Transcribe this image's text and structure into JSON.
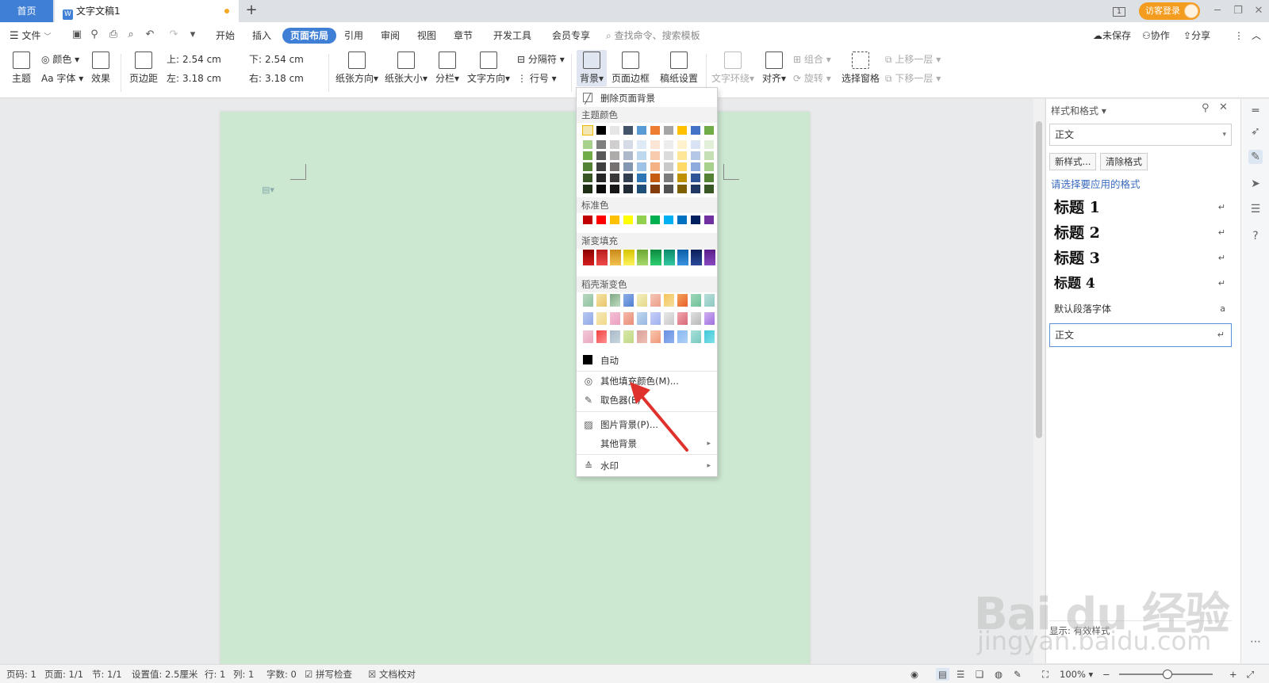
{
  "titlebar": {
    "home_tab": "首页",
    "doc_tab": "文字文稿1",
    "doc_icon": "W",
    "new_tab": "+",
    "login": "访客登录",
    "page_indicator": "1"
  },
  "menubar": {
    "file": "文件",
    "tabs": [
      "开始",
      "插入",
      "页面布局",
      "引用",
      "审阅",
      "视图",
      "章节",
      "开发工具",
      "会员专享"
    ],
    "active_tab": "页面布局",
    "search_placeholder": "查找命令、搜索模板",
    "unsaved": "未保存",
    "collab": "协作",
    "share": "分享"
  },
  "ribbon": {
    "theme": "主题",
    "colors": "颜色",
    "font": "字体",
    "effects": "效果",
    "margins": "页边距",
    "top_label": "上:",
    "top_value": "2.54 cm",
    "bottom_label": "下:",
    "bottom_value": "2.54 cm",
    "left_label": "左:",
    "left_value": "3.18 cm",
    "right_label": "右:",
    "right_value": "3.18 cm",
    "orientation": "纸张方向",
    "size": "纸张大小",
    "columns": "分栏",
    "text_direction": "文字方向",
    "breaks": "分隔符",
    "line_numbers": "行号",
    "background": "背景",
    "page_border": "页面边框",
    "manuscript": "稿纸设置",
    "text_wrap": "文字环绕",
    "align": "对齐",
    "group": "组合",
    "rotate": "旋转",
    "selection_pane": "选择窗格",
    "bring_forward": "上移一层",
    "send_backward": "下移一层"
  },
  "dropdown": {
    "delete_bg": "删除页面背景",
    "theme_colors_label": "主题颜色",
    "standard_colors_label": "标准色",
    "gradient_label": "渐变填充",
    "docer_gradient_label": "稻壳渐变色",
    "auto": "自动",
    "more_colors": "其他填充颜色(M)...",
    "eyedropper": "取色器(E)",
    "picture_bg": "图片背景(P)...",
    "other_bg": "其他背景",
    "watermark": "水印",
    "theme_top_row": [
      "#f4e6b3",
      "#000000",
      "#e7e6e6",
      "#44546a",
      "#5b9bd5",
      "#ed7d31",
      "#a5a5a5",
      "#ffc000",
      "#4472c4",
      "#70ad47"
    ],
    "theme_shades": [
      [
        "#a9d18e",
        "#7f7f7f",
        "#d0cece",
        "#d6dce5",
        "#deebf7",
        "#fbe5d6",
        "#ededed",
        "#fff2cc",
        "#dae3f3",
        "#e2f0d9"
      ],
      [
        "#70ad47",
        "#595959",
        "#aeabab",
        "#adb9ca",
        "#bdd7ee",
        "#f8cbad",
        "#dbdbdb",
        "#ffe699",
        "#b4c7e7",
        "#c5e0b4"
      ],
      [
        "#548235",
        "#3f3f3f",
        "#757171",
        "#8497b0",
        "#9dc3e6",
        "#f4b183",
        "#c9c9c9",
        "#ffd966",
        "#8faadc",
        "#a9d18e"
      ],
      [
        "#375623",
        "#262626",
        "#3a3838",
        "#333f50",
        "#2e75b6",
        "#c55a11",
        "#7b7b7b",
        "#bf9000",
        "#2f5597",
        "#548235"
      ],
      [
        "#1e2e14",
        "#0c0c0c",
        "#171616",
        "#222a35",
        "#1f4e79",
        "#843c0c",
        "#525252",
        "#7f6000",
        "#203864",
        "#385723"
      ]
    ],
    "standard_colors": [
      "#c00000",
      "#ff0000",
      "#ffc000",
      "#ffff00",
      "#92d050",
      "#00b050",
      "#00b0f0",
      "#0070c0",
      "#002060",
      "#7030a0"
    ],
    "gradient_colors": [
      [
        "#8b0000",
        "#d42020"
      ],
      [
        "#b81c1c",
        "#f04a4a"
      ],
      [
        "#c98a1a",
        "#f2c14e"
      ],
      [
        "#d6c400",
        "#fff35c"
      ],
      [
        "#6da834",
        "#a8d86d"
      ],
      [
        "#0c8a3e",
        "#2fcf72"
      ],
      [
        "#0d8a6a",
        "#33c9a0"
      ],
      [
        "#0b5fa8",
        "#3a93e0"
      ],
      [
        "#0b1f5a",
        "#2a4a9a"
      ],
      [
        "#5a1f8a",
        "#8a4ac0"
      ]
    ],
    "docer_gradients": [
      [
        "#b7d8c0",
        "#8fc2a0"
      ],
      [
        "#f6e3a8",
        "#e8c56a"
      ],
      [
        "#7ea884",
        "#c0dcc2"
      ],
      [
        "#8fb0e8",
        "#4f7fd0"
      ],
      [
        "#f3efc0",
        "#e5d98a"
      ],
      [
        "#f5c6b8",
        "#ec9f88"
      ],
      [
        "#f6c45a",
        "#f4e0a0"
      ],
      [
        "#f4a35a",
        "#e8612a"
      ],
      [
        "#a0d8b8",
        "#6cc09a"
      ],
      [
        "#b8e0da",
        "#8cc8c0"
      ],
      [
        "#b8c8f0",
        "#90a8e8"
      ],
      [
        "#f6e9b8",
        "#f0d888"
      ],
      [
        "#f5c0d6",
        "#eaa0c0"
      ],
      [
        "#f6b9a8",
        "#e88e78"
      ],
      [
        "#c0d8f0",
        "#98b8e0"
      ],
      [
        "#c8d0f8",
        "#a0b0f0"
      ],
      [
        "#e8e8e8",
        "#c8c8c8"
      ],
      [
        "#f0a8b0",
        "#d86878"
      ],
      [
        "#e0e0e0",
        "#b8b8b8"
      ],
      [
        "#d0b0f0",
        "#a070e0"
      ],
      [
        "#f4c8d8",
        "#e8a8c0"
      ],
      [
        "#f04040",
        "#ff9090"
      ],
      [
        "#a8b8c8",
        "#c8d8e0"
      ],
      [
        "#d8e8a8",
        "#c0d888"
      ],
      [
        "#d8a0a0",
        "#f0c0b0"
      ],
      [
        "#f8c8b0",
        "#f09878"
      ],
      [
        "#6890e0",
        "#90b0f0"
      ],
      [
        "#88b8f0",
        "#b0d0f8"
      ],
      [
        "#a8e0d8",
        "#78c8c0"
      ],
      [
        "#40c8d8",
        "#80e0e8"
      ]
    ]
  },
  "sidepanel": {
    "title": "样式和格式",
    "current_style": "正文",
    "new_style": "新样式...",
    "clear_format": "清除格式",
    "choose_label": "请选择要应用的格式",
    "styles": [
      {
        "name": "标题  1",
        "kind": "heading"
      },
      {
        "name": "标题  2",
        "kind": "heading"
      },
      {
        "name": "标题  3",
        "kind": "heading"
      },
      {
        "name": "标题  4",
        "kind": "heading4"
      },
      {
        "name": "默认段落字体",
        "kind": "small"
      },
      {
        "name": "正文",
        "kind": "selected"
      }
    ],
    "show_label": "显示:",
    "show_value": "有效样式"
  },
  "statusbar": {
    "page_num": "页码: 1",
    "pages": "页面: 1/1",
    "section": "节: 1/1",
    "setting": "设置值: 2.5厘米",
    "line": "行: 1",
    "col": "列: 1",
    "words": "字数: 0",
    "spell_check": "拼写检查",
    "doc_proof": "文档校对",
    "zoom": "100%"
  },
  "watermark": {
    "brand": "Bai du 经验",
    "url": "jingyan.baidu.com"
  }
}
